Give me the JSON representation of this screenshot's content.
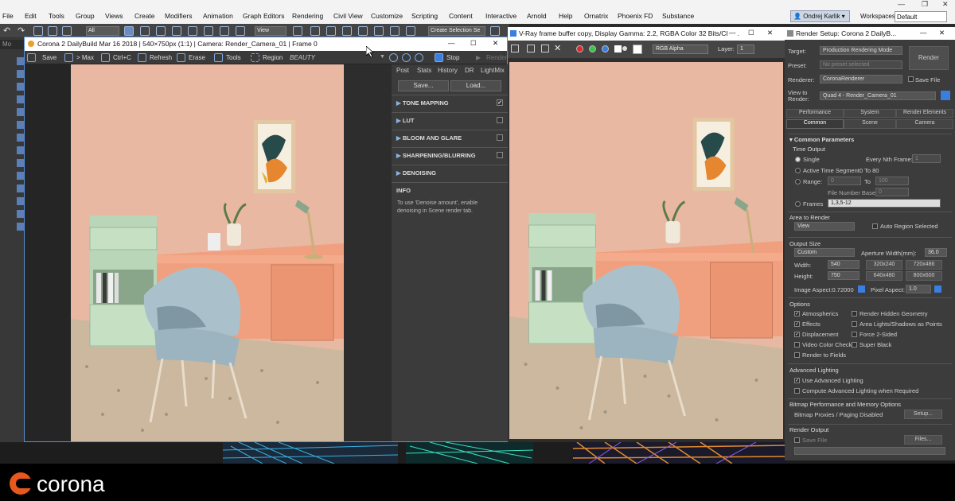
{
  "menubar": {
    "items": [
      "File",
      "Edit",
      "Tools",
      "Group",
      "Views",
      "Create",
      "Modifiers",
      "Animation",
      "Graph Editors",
      "Rendering",
      "Civil View",
      "Customize",
      "Scripting",
      "Content",
      "Interactive",
      "Arnold",
      "Help",
      "Ornatrix",
      "Phoenix FD",
      "Substance"
    ],
    "user": "Ondrej Karlik",
    "workspaces_label": "Workspaces:",
    "workspaces_value": "Default"
  },
  "maintoolbar": {
    "all_dropdown": "All",
    "view_dropdown": "View",
    "selection_set": "Create Selection Se",
    "tab_mo": "Mo"
  },
  "corona_vfb": {
    "title": "Corona 2 DailyBuild Mar 16 2018 | 540×750px (1:1) | Camera: Render_Camera_01 | Frame 0",
    "toolbar": {
      "save": "Save",
      "max": "> Max",
      "ctrlc": "Ctrl+C",
      "refresh": "Refresh",
      "erase": "Erase",
      "tools": "Tools",
      "region": "Region",
      "beauty": "BEAUTY",
      "stop": "Stop",
      "render": "Render"
    },
    "post": {
      "tabs": [
        "Post",
        "Stats",
        "History",
        "DR",
        "LightMix"
      ],
      "save_btn": "Save...",
      "load_btn": "Load...",
      "sections": [
        {
          "label": "TONE MAPPING",
          "checked": true
        },
        {
          "label": "LUT",
          "checked": false
        },
        {
          "label": "BLOOM AND GLARE",
          "checked": false
        },
        {
          "label": "SHARPENING/BLURRING",
          "checked": false
        },
        {
          "label": "DENOISING",
          "checked": false
        }
      ],
      "info_title": "INFO",
      "info_text": "To use 'Denoise amount', enable denoising in Scene render tab."
    }
  },
  "vray_vfb": {
    "title": "V-Ray frame buffer copy, Display Gamma: 2.2, RGBA Color 32 Bits/Cha...",
    "channel": "RGB Alpha",
    "layer_label": "Layer:",
    "layer_value": "1",
    "colors": [
      "#e0272a",
      "#3ac44a",
      "#3a7fe0",
      "#ffffff"
    ]
  },
  "render_setup": {
    "title": "Render Setup: Corona 2 DailyB...",
    "target_label": "Target:",
    "target": "Production Rendering Mode",
    "preset_label": "Preset:",
    "preset": "No preset selected",
    "render_btn": "Render",
    "renderer_label": "Renderer:",
    "renderer": "CoronaRenderer",
    "save_file": "Save File",
    "view_label": "View to\nRender:",
    "view": "Quad 4 - Render_Camera_01",
    "tabs_row1": [
      "Performance",
      "System",
      "Render Elements"
    ],
    "tabs_row2": [
      "Common",
      "Scene",
      "Camera"
    ],
    "rollout": "Common Parameters",
    "time_output": "Time Output",
    "single": "Single",
    "every_nth": "Every Nth Frame:",
    "every_nth_val": "1",
    "active_seg": "Active Time Segment:",
    "active_seg_val": "0 To 80",
    "range": "Range:",
    "range_from": "0",
    "range_to_label": "To",
    "range_to": "100",
    "file_num": "File Number Base:",
    "file_num_val": "0",
    "frames": "Frames",
    "frames_val": "1,3,5-12",
    "area": "Area to Render",
    "area_val": "View",
    "auto_region": "Auto Region Selected",
    "output_size": "Output Size",
    "size_preset": "Custom",
    "aperture_label": "Aperture Width(mm):",
    "aperture": "36.0",
    "width_label": "Width:",
    "width": "540",
    "height_label": "Height:",
    "height": "750",
    "presets": [
      "320x240",
      "720x486",
      "640x480",
      "800x600"
    ],
    "image_aspect": "Image Aspect:0.72000",
    "pixel_aspect_label": "Pixel Aspect:",
    "pixel_aspect": "1.0",
    "options": "Options",
    "opts": [
      {
        "label": "Atmospherics",
        "checked": true
      },
      {
        "label": "Render Hidden Geometry",
        "checked": false
      },
      {
        "label": "Effects",
        "checked": true
      },
      {
        "label": "Area Lights/Shadows as Points",
        "checked": false
      },
      {
        "label": "Displacement",
        "checked": true
      },
      {
        "label": "Force 2-Sided",
        "checked": false
      },
      {
        "label": "Video Color Check",
        "checked": false
      },
      {
        "label": "Super Black",
        "checked": false
      },
      {
        "label": "Render to Fields",
        "checked": false
      }
    ],
    "adv_light": "Advanced Lighting",
    "use_adv": "Use Advanced Lighting",
    "compute_adv": "Compute Advanced Lighting when Required",
    "bitmap": "Bitmap Performance and Memory Options",
    "bitmap_proxies": "Bitmap Proxies / Paging Disabled",
    "setup_btn": "Setup...",
    "render_output": "Render Output",
    "save_file2": "Save File",
    "files_btn": "Files..."
  },
  "brand": {
    "name": "corona",
    "color": "#e8571e"
  }
}
